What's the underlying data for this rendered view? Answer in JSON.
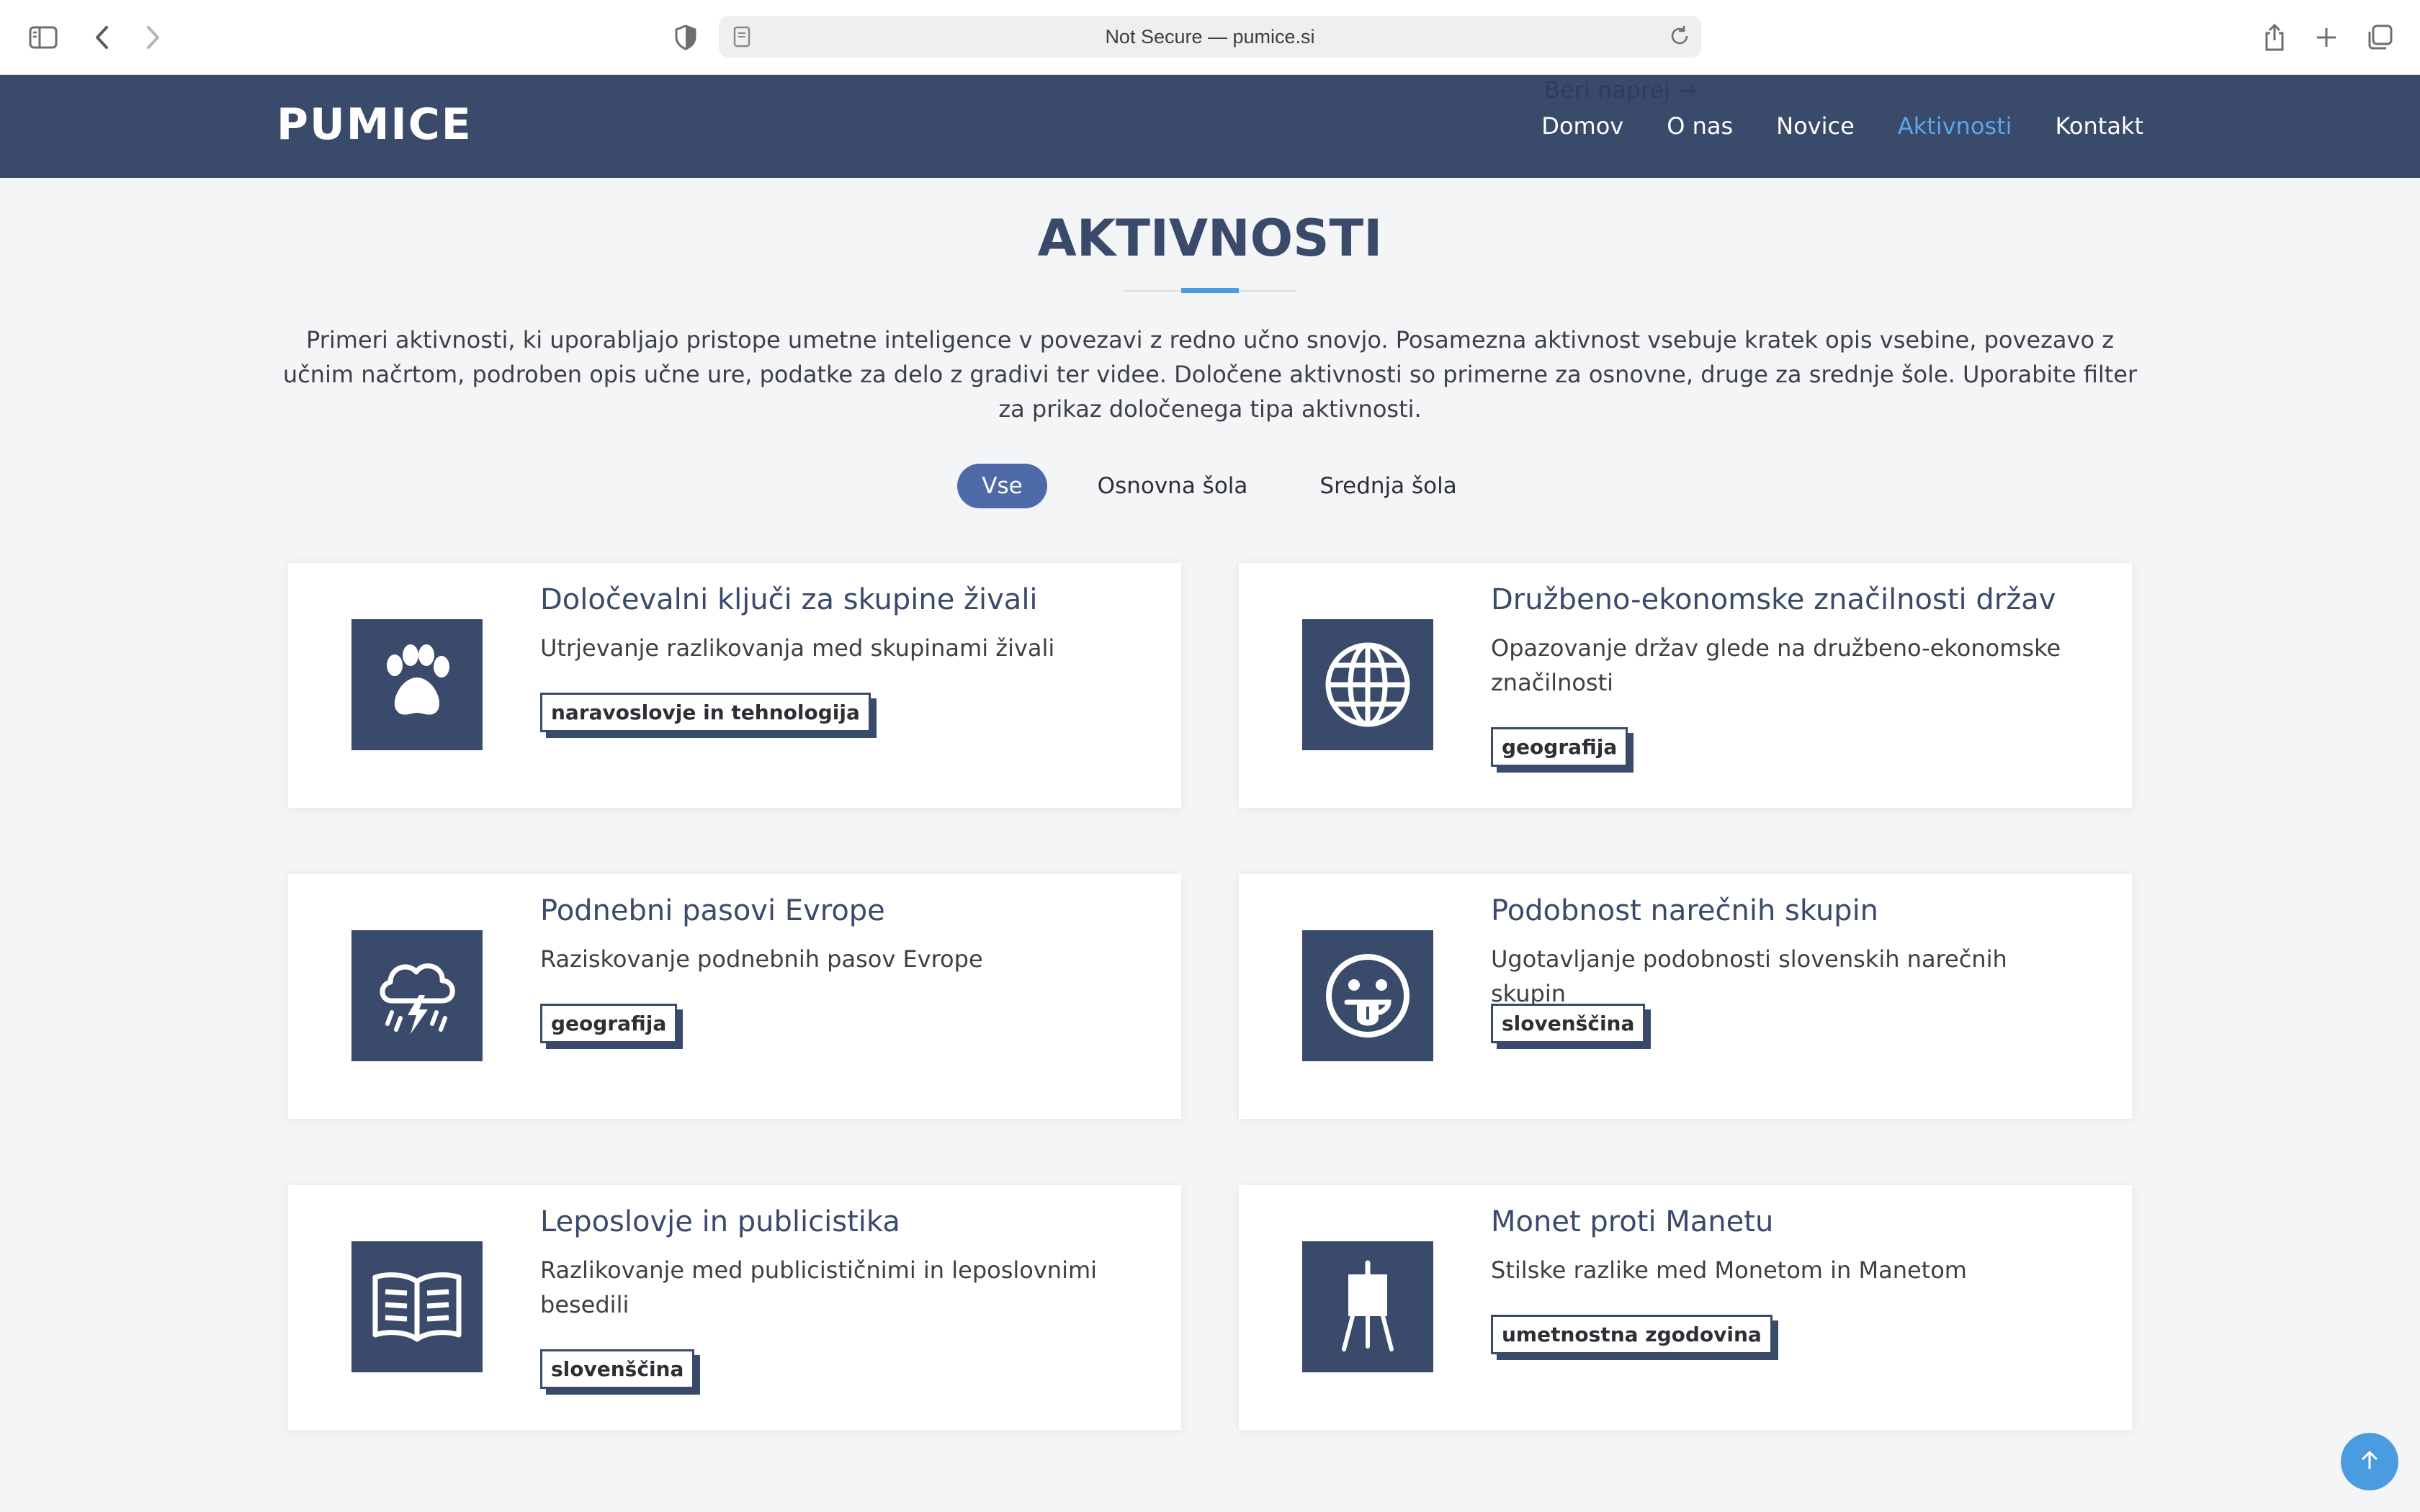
{
  "browser": {
    "address": "Not Secure — pumice.si"
  },
  "header": {
    "logo": "PUMICE",
    "ghost_link": "Beri naprej →",
    "nav": [
      {
        "label": "Domov"
      },
      {
        "label": "O nas"
      },
      {
        "label": "Novice"
      },
      {
        "label": "Aktivnosti",
        "active": true
      },
      {
        "label": "Kontakt"
      }
    ]
  },
  "main": {
    "title": "AKTIVNOSTI",
    "intro": "Primeri aktivnosti, ki uporabljajo pristope umetne inteligence v povezavi z redno učno snovjo. Posamezna aktivnost vsebuje kratek opis vsebine, povezavo z učnim načrtom, podroben opis učne ure, podatke za delo z gradivi ter videe. Določene aktivnosti so primerne za osnovne, druge za srednje šole. Uporabite filter za prikaz določenega tipa aktivnosti.",
    "filters": [
      {
        "label": "Vse",
        "active": true
      },
      {
        "label": "Osnovna šola"
      },
      {
        "label": "Srednja šola"
      }
    ],
    "cards": [
      {
        "title": "Določevalni ključi za skupine živali",
        "desc": "Utrjevanje razlikovanja med skupinami živali",
        "tag": "naravoslovje in tehnologija",
        "icon": "paw-icon"
      },
      {
        "title": "Družbeno-ekonomske značilnosti držav",
        "desc": "Opazovanje držav glede na družbeno-ekonomske značilnosti",
        "tag": "geografija",
        "icon": "globe-icon"
      },
      {
        "title": "Podnebni pasovi Evrope",
        "desc": "Raziskovanje podnebnih pasov Evrope",
        "tag": "geografija",
        "icon": "storm-cloud-icon"
      },
      {
        "title": "Podobnost narečnih skupin",
        "desc": "Ugotavljanje podobnosti slovenskih narečnih skupin",
        "tag": "slovenščina",
        "icon": "tongue-face-icon"
      },
      {
        "title": "Leposlovje in publicistika",
        "desc": "Razlikovanje med publicističnimi in leposlovnimi besedili",
        "tag": "slovenščina",
        "icon": "book-icon"
      },
      {
        "title": "Monet proti Manetu",
        "desc": "Stilske razlike med Monetom in Manetom",
        "tag": "umetnostna zgodovina",
        "icon": "easel-icon"
      }
    ]
  },
  "colors": {
    "header_bg": "#3a4a6b",
    "accent": "#4a9be0",
    "filter_active": "#4f6aa8"
  }
}
